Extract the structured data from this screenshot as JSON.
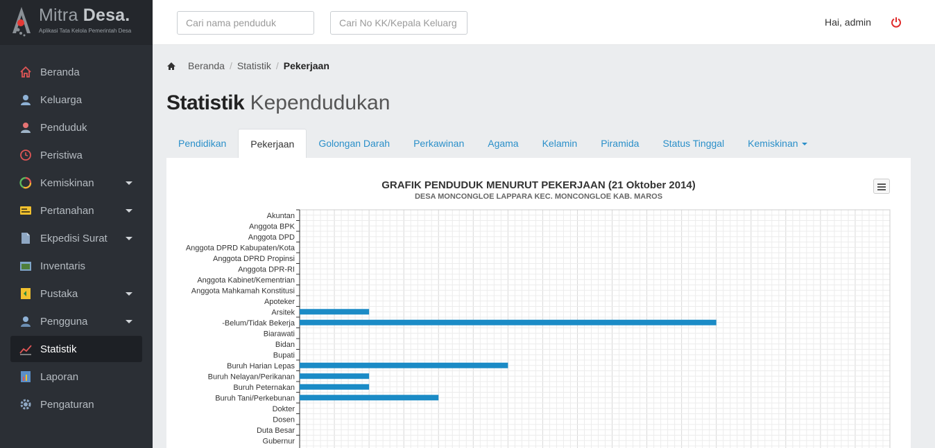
{
  "brand": {
    "name_light": "Mitra",
    "name_bold": "Desa.",
    "subtitle": "Aplikasi Tata Kelola Pemerintah Desa"
  },
  "sidebar": {
    "items": [
      {
        "label": "Beranda",
        "icon": "home-icon",
        "has_caret": false
      },
      {
        "label": "Keluarga",
        "icon": "family-icon",
        "has_caret": false
      },
      {
        "label": "Penduduk",
        "icon": "people-icon",
        "has_caret": false
      },
      {
        "label": "Peristiwa",
        "icon": "clock-icon",
        "has_caret": false
      },
      {
        "label": "Kemiskinan",
        "icon": "cycle-icon",
        "has_caret": true
      },
      {
        "label": "Pertanahan",
        "icon": "land-icon",
        "has_caret": true
      },
      {
        "label": "Ekpedisi Surat",
        "icon": "document-icon",
        "has_caret": true
      },
      {
        "label": "Inventaris",
        "icon": "inventory-icon",
        "has_caret": false
      },
      {
        "label": "Pustaka",
        "icon": "book-icon",
        "has_caret": true
      },
      {
        "label": "Pengguna",
        "icon": "user-icon",
        "has_caret": true
      },
      {
        "label": "Statistik",
        "icon": "chart-line-icon",
        "has_caret": false,
        "active": true
      },
      {
        "label": "Laporan",
        "icon": "report-icon",
        "has_caret": false
      },
      {
        "label": "Pengaturan",
        "icon": "gear-icon",
        "has_caret": false
      }
    ]
  },
  "topbar": {
    "search_name_placeholder": "Cari nama penduduk",
    "search_kk_placeholder": "Cari No KK/Kepala Keluarg",
    "greeting": "Hai, admin"
  },
  "breadcrumb": {
    "home": "Beranda",
    "section": "Statistik",
    "current": "Pekerjaan"
  },
  "page_title": {
    "bold": "Statistik",
    "light": "Kependudukan"
  },
  "tabs": [
    {
      "label": "Pendidikan"
    },
    {
      "label": "Pekerjaan",
      "active": true
    },
    {
      "label": "Golongan Darah"
    },
    {
      "label": "Perkawinan"
    },
    {
      "label": "Agama"
    },
    {
      "label": "Kelamin"
    },
    {
      "label": "Piramida"
    },
    {
      "label": "Status Tinggal"
    },
    {
      "label": "Kemiskinan",
      "dropdown": true
    }
  ],
  "colors": {
    "accent": "#2a8fc9",
    "bar": "#1b8bc6",
    "power": "#e02a2a",
    "sidebar_bg": "#2b2f35"
  },
  "chart_data": {
    "type": "bar",
    "orientation": "horizontal",
    "title": "GRAFIK PENDUDUK MENURUT PEKERJAAN (21 Oktober 2014)",
    "subtitle": "DESA MONCONGLOE LAPPARA KEC. MONCONGLOE KAB. MAROS",
    "categories": [
      "Akuntan",
      "Anggota BPK",
      "Anggota DPD",
      "Anggota DPRD Kabupaten/Kota",
      "Anggota DPRD Propinsi",
      "Anggota DPR-RI",
      "Anggota Kabinet/Kementrian",
      "Anggota Mahkamah Konstitusi",
      "Apoteker",
      "Arsitek",
      "-Belum/Tidak Bekerja",
      "Biarawati",
      "Bidan",
      "Bupati",
      "Buruh Harian Lepas",
      "Buruh Nelayan/Perikanan",
      "Buruh Peternakan",
      "Buruh Tani/Perkebunan",
      "Dokter",
      "Dosen",
      "Duta Besar",
      "Gubernur"
    ],
    "values": [
      0,
      0,
      0,
      0,
      0,
      0,
      0,
      0,
      0,
      1,
      6,
      0,
      0,
      0,
      3,
      1,
      1,
      2,
      0,
      0,
      0,
      0
    ],
    "xlim": [
      0,
      8.5
    ],
    "grid": true,
    "legend": "none"
  }
}
